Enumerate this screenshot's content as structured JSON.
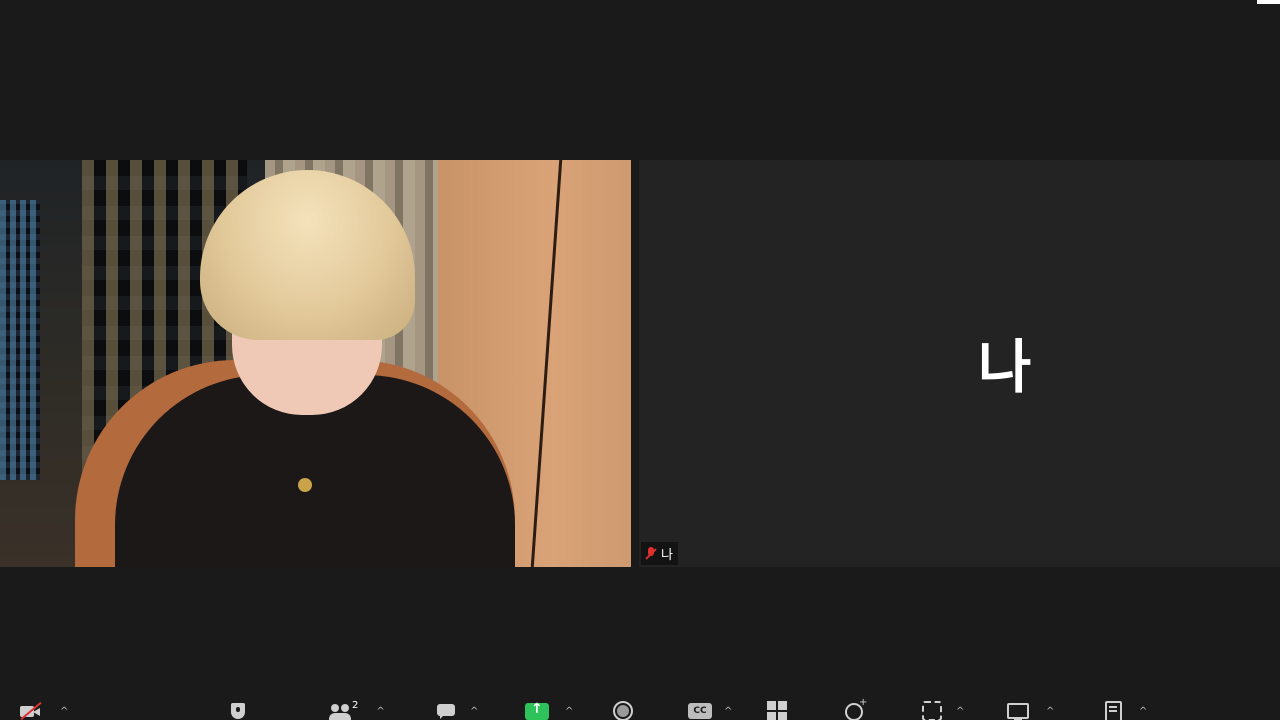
{
  "meeting": {
    "self_tile": {
      "display_name": "나",
      "name_tag": "나",
      "mic_status": "muted"
    },
    "remote_tile": {
      "video_on": true
    }
  },
  "toolbar": {
    "participants_count": "2",
    "caret": "^",
    "items": [
      {
        "name": "video-off",
        "icon": "video-slash-icon",
        "has_caret": true
      },
      {
        "name": "security",
        "icon": "shield-icon",
        "has_caret": false
      },
      {
        "name": "participants",
        "icon": "people-icon",
        "has_caret": true
      },
      {
        "name": "chat",
        "icon": "chat-icon",
        "has_caret": true
      },
      {
        "name": "share-screen",
        "icon": "share-screen-icon",
        "has_caret": true
      },
      {
        "name": "record",
        "icon": "record-icon",
        "has_caret": false
      },
      {
        "name": "closed-captions",
        "icon": "cc-icon",
        "has_caret": true
      },
      {
        "name": "apps",
        "icon": "apps-grid-icon",
        "has_caret": false
      },
      {
        "name": "reactions",
        "icon": "reactions-icon",
        "has_caret": false
      },
      {
        "name": "focus",
        "icon": "focus-icon",
        "has_caret": true
      },
      {
        "name": "screen",
        "icon": "screen-icon",
        "has_caret": true
      },
      {
        "name": "notes",
        "icon": "notes-icon",
        "has_caret": true
      }
    ],
    "share_color": "#2dc35a",
    "mute_color": "#e02f2f"
  }
}
